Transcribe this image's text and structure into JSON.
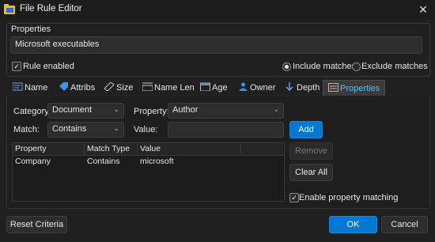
{
  "window": {
    "title": "File Rule Editor",
    "close_icon": "close-icon"
  },
  "properties_group": {
    "label": "Properties",
    "name_value": "Microsoft executables",
    "rule_enabled_label": "Rule enabled",
    "rule_enabled_checked": true,
    "include_label": "Include matches",
    "exclude_label": "Exclude matches",
    "selected_mode": "include"
  },
  "tabs": [
    {
      "label": "Name",
      "icon": "name-icon"
    },
    {
      "label": "Attribs",
      "icon": "tag-icon"
    },
    {
      "label": "Size",
      "icon": "ruler-icon"
    },
    {
      "label": "Name Len",
      "icon": "name-length-icon"
    },
    {
      "label": "Age",
      "icon": "calendar-icon"
    },
    {
      "label": "Owner",
      "icon": "user-icon"
    },
    {
      "label": "Depth",
      "icon": "arrow-down-icon"
    },
    {
      "label": "Properties",
      "icon": "properties-icon",
      "active": true
    }
  ],
  "filter": {
    "category_label": "Category:",
    "category_value": "Document",
    "property_label": "Property:",
    "property_value": "Author",
    "match_label": "Match:",
    "match_value": "Contains",
    "value_label": "Value:",
    "value_value": ""
  },
  "table": {
    "columns": [
      "Property",
      "Match Type",
      "Value",
      ""
    ],
    "rows": [
      [
        "Company",
        "Contains",
        "microsoft"
      ]
    ]
  },
  "actions": {
    "add_label": "Add",
    "remove_label": "Remove",
    "clear_all_label": "Clear All",
    "enable_matching_label": "Enable property matching",
    "enable_matching_checked": true
  },
  "footer": {
    "reset_label": "Reset Criteria",
    "ok_label": "OK",
    "cancel_label": "Cancel"
  },
  "colors": {
    "accent": "#0078d4",
    "active_tab_text": "#4cc2ff",
    "background": "#202020"
  }
}
